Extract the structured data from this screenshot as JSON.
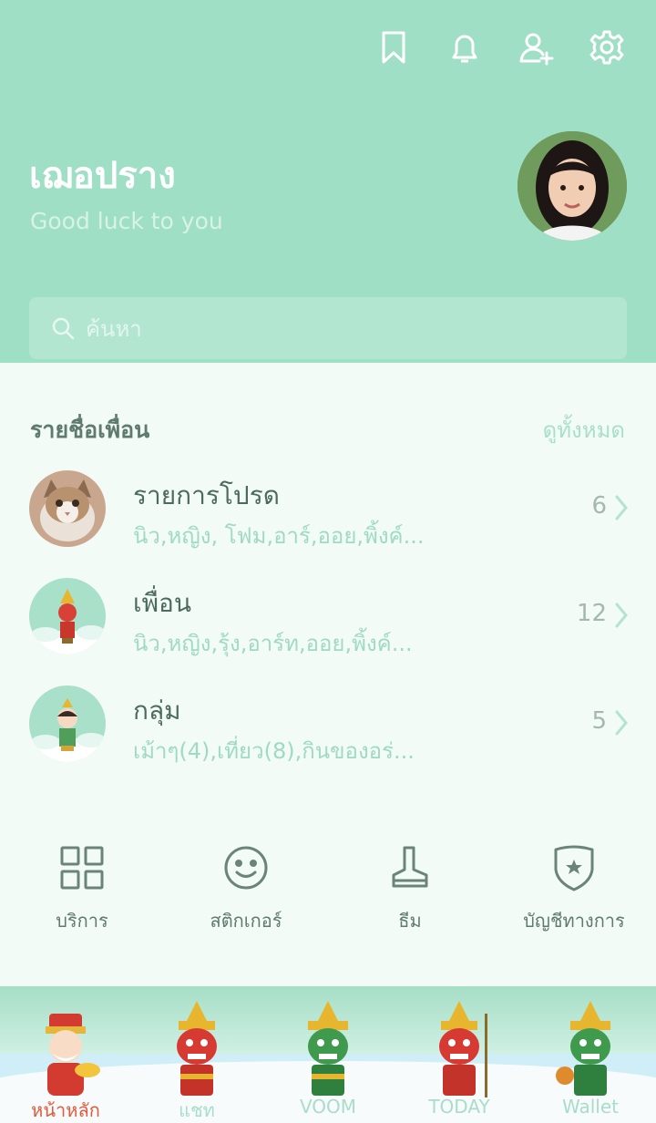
{
  "header": {
    "icons": [
      "bookmark-icon",
      "bell-icon",
      "add-friend-icon",
      "gear-icon"
    ],
    "profile_name": "เฌอปราง",
    "status_message": "Good luck to you"
  },
  "search": {
    "placeholder": "ค้นหา"
  },
  "friends": {
    "title": "รายชื่อเพื่อน",
    "see_all": "ดูทั้งหมด",
    "rows": [
      {
        "title": "รายการโปรด",
        "subtitle": "นิว,หญิง, โฟม,อาร์,ออย,พิ้งค์...",
        "count": "6"
      },
      {
        "title": "เพื่อน",
        "subtitle": "นิว,หญิง,รุ้ง,อาร์ท,ออย,พิ้งค์...",
        "count": "12"
      },
      {
        "title": "กลุ่ม",
        "subtitle": "เม้าๆ(4),เที่ยว(8),กินของอร่...",
        "count": "5"
      }
    ]
  },
  "quick_actions": [
    {
      "label": "บริการ",
      "icon": "grid-icon"
    },
    {
      "label": "สติกเกอร์",
      "icon": "smile-icon"
    },
    {
      "label": "ธีม",
      "icon": "brush-icon"
    },
    {
      "label": "บัญชีทางการ",
      "icon": "shield-star-icon"
    }
  ],
  "bottom_nav": [
    {
      "label": "หน้าหลัก",
      "active": true
    },
    {
      "label": "แชท",
      "active": false
    },
    {
      "label": "VOOM",
      "active": false
    },
    {
      "label": "TODAY",
      "active": false
    },
    {
      "label": "Wallet",
      "active": false
    }
  ],
  "colors": {
    "header_bg": "#9fdfc5",
    "body_bg": "#f3fbf7",
    "accent_text": "#9fdac3",
    "active_tab": "#e35a3c"
  }
}
